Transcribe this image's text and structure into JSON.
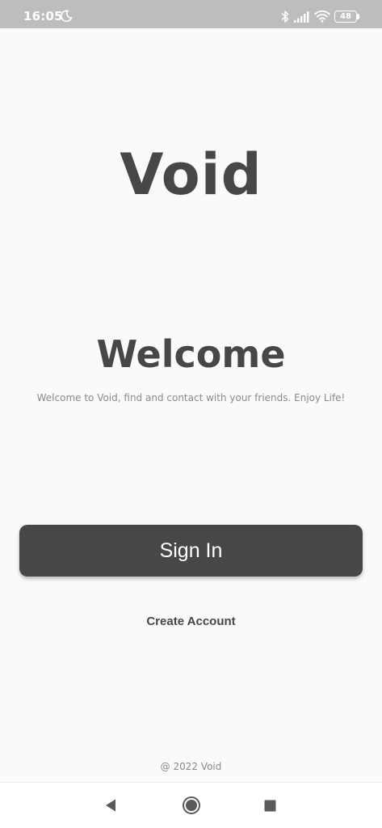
{
  "status_bar": {
    "time": "16:05",
    "battery_level": "48",
    "icons": [
      "moon-icon",
      "bluetooth-icon",
      "signal-icon",
      "wifi-icon",
      "battery-icon"
    ]
  },
  "app": {
    "logo_text": "Void",
    "welcome_title": "Welcome",
    "welcome_subtitle": "Welcome to Void, find and contact with your friends. Enjoy Life!",
    "sign_in_label": "Sign In",
    "create_account_label": "Create Account",
    "footer": "@ 2022 Void"
  },
  "nav_bar": {
    "icons": [
      "back-icon",
      "home-icon",
      "recents-icon"
    ]
  },
  "colors": {
    "primary": "#474747",
    "background": "#fafafa",
    "status_bar": "#bdbdbd",
    "muted_text": "#8a8a8a"
  }
}
